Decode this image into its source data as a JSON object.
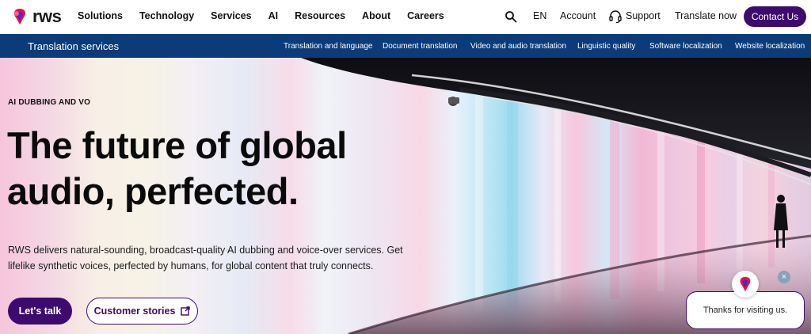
{
  "brand": {
    "name": "rws",
    "accent": "#3d0b6e",
    "subnav_bg": "#0c3b7a"
  },
  "nav": {
    "items": [
      "Solutions",
      "Technology",
      "Services",
      "AI",
      "Resources",
      "About",
      "Careers"
    ],
    "language": "EN",
    "account": "Account",
    "support": "Support",
    "translate_now": "Translate now",
    "contact": "Contact Us",
    "search_icon": "search-icon"
  },
  "subnav": {
    "section": "Translation services",
    "items": [
      "Translation and language",
      "Document translation",
      "Video and audio translation",
      "Linguistic quality",
      "Software localization",
      "Website localization"
    ]
  },
  "hero": {
    "eyebrow": "AI DUBBING AND VO",
    "headline_line1": "The future of global",
    "headline_line2": "audio, perfected.",
    "body": "RWS delivers natural-sounding, broadcast-quality AI dubbing and voice-over services. Get lifelike synthetic voices, perfected by humans, for global content that truly connects.",
    "primary_cta": "Let's talk",
    "secondary_cta": "Customer stories"
  },
  "chat": {
    "message": "Thanks for visiting us.",
    "close_symbol": "×"
  }
}
